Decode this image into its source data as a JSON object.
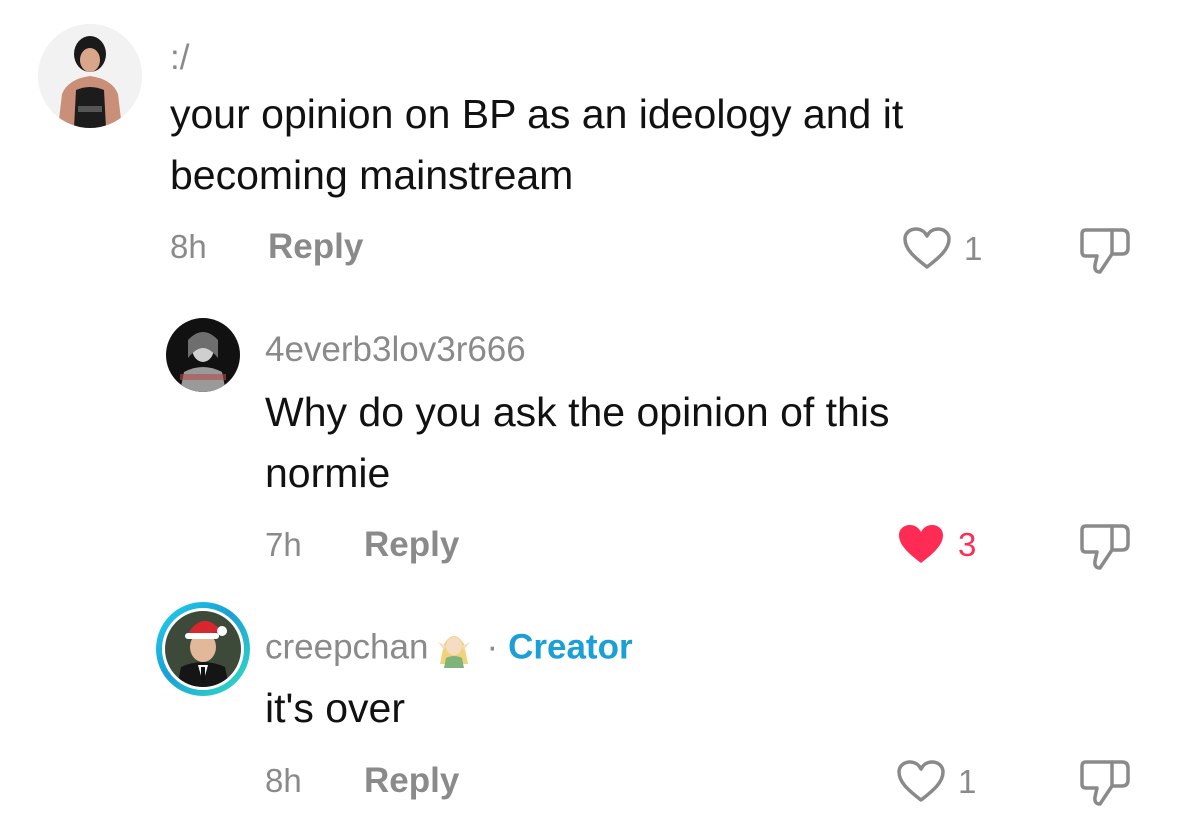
{
  "comments": [
    {
      "username": ":/",
      "text_lines": [
        "your opinion on BP as an ideology and it",
        "becoming mainstream"
      ],
      "time": "8h",
      "reply_label": "Reply",
      "likes": "1",
      "liked": false
    },
    {
      "username": "4everb3lov3r666",
      "text_lines": [
        "Why do you ask the opinion of this",
        "normie"
      ],
      "time": "7h",
      "reply_label": "Reply",
      "likes": "3",
      "liked": true
    },
    {
      "username": "creepchan",
      "creator_label": "Creator",
      "text_lines": [
        "it's over"
      ],
      "time": "8h",
      "reply_label": "Reply",
      "likes": "1",
      "liked": false
    }
  ],
  "colors": {
    "liked": "#fe2c55",
    "creator": "#1a9fd6",
    "muted": "#8a8a8a"
  },
  "icons": {
    "like": "heart-outline-icon",
    "liked": "heart-filled-icon",
    "dislike": "thumbs-down-icon"
  }
}
